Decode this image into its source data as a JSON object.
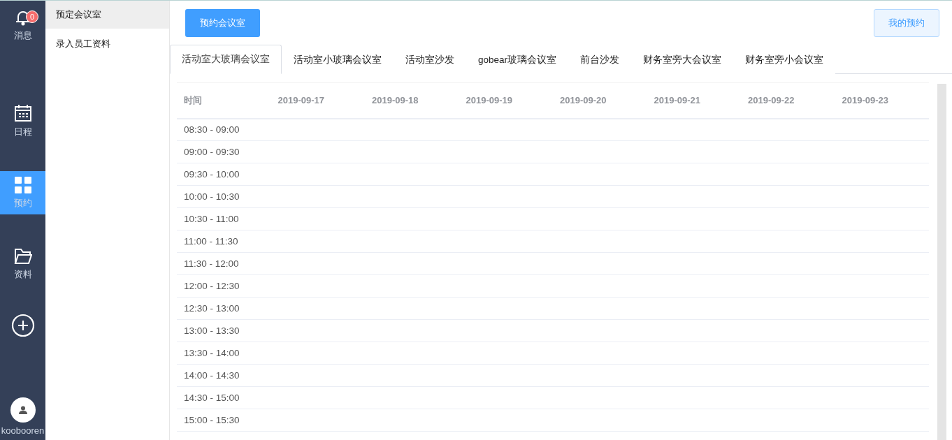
{
  "nav": [
    {
      "label": "消息",
      "badge": "0",
      "selected": false
    },
    {
      "label": "日程",
      "selected": false
    },
    {
      "label": "预约",
      "selected": true
    },
    {
      "label": "资料",
      "selected": false
    }
  ],
  "user": {
    "name": "koobooren"
  },
  "submenu": [
    {
      "label": "预定会议室",
      "selected": true
    },
    {
      "label": "录入员工资料",
      "selected": false
    }
  ],
  "toolbar": {
    "primary": "预约会议室",
    "secondary": "我的预约"
  },
  "tabs": [
    {
      "label": "活动室大玻璃会议室",
      "selected": true
    },
    {
      "label": "活动室小玻璃会议室",
      "selected": false
    },
    {
      "label": "活动室沙发",
      "selected": false
    },
    {
      "label": "gobear玻璃会议室",
      "selected": false
    },
    {
      "label": "前台沙发",
      "selected": false
    },
    {
      "label": "财务室旁大会议室",
      "selected": false
    },
    {
      "label": "财务室旁小会议室",
      "selected": false
    }
  ],
  "table": {
    "columns": [
      "时间",
      "2019-09-17",
      "2019-09-18",
      "2019-09-19",
      "2019-09-20",
      "2019-09-21",
      "2019-09-22",
      "2019-09-23"
    ],
    "rows": [
      "08:30 - 09:00",
      "09:00 - 09:30",
      "09:30 - 10:00",
      "10:00 - 10:30",
      "10:30 - 11:00",
      "11:00 - 11:30",
      "11:30 - 12:00",
      "12:00 - 12:30",
      "12:30 - 13:00",
      "13:00 - 13:30",
      "13:30 - 14:00",
      "14:00 - 14:30",
      "14:30 - 15:00",
      "15:00 - 15:30"
    ]
  }
}
